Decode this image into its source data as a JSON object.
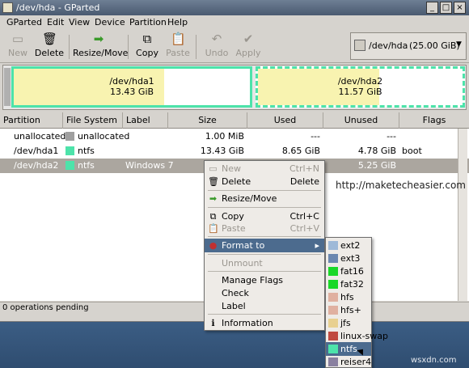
{
  "window": {
    "title": "/dev/hda - GParted"
  },
  "menubar": [
    "GParted",
    "Edit",
    "View",
    "Device",
    "Partition",
    "Help"
  ],
  "toolbar": {
    "new": "New",
    "delete": "Delete",
    "resize": "Resize/Move",
    "copy": "Copy",
    "paste": "Paste",
    "undo": "Undo",
    "apply": "Apply"
  },
  "device": {
    "label": "/dev/hda",
    "size": "(25.00 GiB)"
  },
  "graph": [
    {
      "name": "/dev/hda1",
      "size": "13.43 GiB"
    },
    {
      "name": "/dev/hda2",
      "size": "11.57 GiB"
    }
  ],
  "table": {
    "headers": [
      "Partition",
      "File System",
      "Label",
      "Size",
      "Used",
      "Unused",
      "Flags"
    ],
    "rows": [
      {
        "partition": "unallocated",
        "fs": "unallocated",
        "label": "",
        "size": "1.00 MiB",
        "used": "---",
        "unused": "---",
        "flags": "",
        "color": "#a0a0a0"
      },
      {
        "partition": "/dev/hda1",
        "fs": "ntfs",
        "label": "",
        "size": "13.43 GiB",
        "used": "8.65 GiB",
        "unused": "4.78 GiB",
        "flags": "boot",
        "color": "#4de3aa"
      },
      {
        "partition": "/dev/hda2",
        "fs": "ntfs",
        "label": "Windows 7",
        "size": "",
        "used": "",
        "unused": "5.25 GiB",
        "flags": "",
        "color": "#4de3aa"
      }
    ]
  },
  "status": "0 operations pending",
  "context_menu": {
    "new": "New",
    "new_key": "Ctrl+N",
    "delete": "Delete",
    "delete_key": "Delete",
    "resize": "Resize/Move",
    "copy": "Copy",
    "copy_key": "Ctrl+C",
    "paste": "Paste",
    "paste_key": "Ctrl+V",
    "format": "Format to",
    "unmount": "Unmount",
    "flags": "Manage Flags",
    "check": "Check",
    "label": "Label",
    "info": "Information"
  },
  "format_menu": [
    {
      "name": "ext2",
      "color": "#9eb9d8"
    },
    {
      "name": "ext3",
      "color": "#6b87b0"
    },
    {
      "name": "fat16",
      "color": "#19d828"
    },
    {
      "name": "fat32",
      "color": "#19d828"
    },
    {
      "name": "hfs",
      "color": "#e0b0a0"
    },
    {
      "name": "hfs+",
      "color": "#e0b0a0"
    },
    {
      "name": "jfs",
      "color": "#e8d090"
    },
    {
      "name": "linux-swap",
      "color": "#c04a40"
    },
    {
      "name": "ntfs",
      "color": "#4de3aa"
    },
    {
      "name": "reiser4",
      "color": "#8a80a0"
    }
  ],
  "overlay": {
    "url": "http://maketecheasier.com",
    "watermark": "wsxdn.com"
  }
}
